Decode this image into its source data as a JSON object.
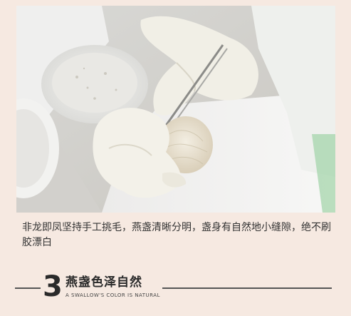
{
  "photo": {
    "icon": "bird-nest-cleaning-photo"
  },
  "caption": {
    "text": "非龙即凤坚持手工挑毛，燕盏清晰分明，盏身有自然地小缝隙，绝不刷胶漂白"
  },
  "section": {
    "number": "3",
    "title_cn": "燕盏色泽自然",
    "title_en": "A SWALLOW'S COLOR IS NATURAL"
  }
}
